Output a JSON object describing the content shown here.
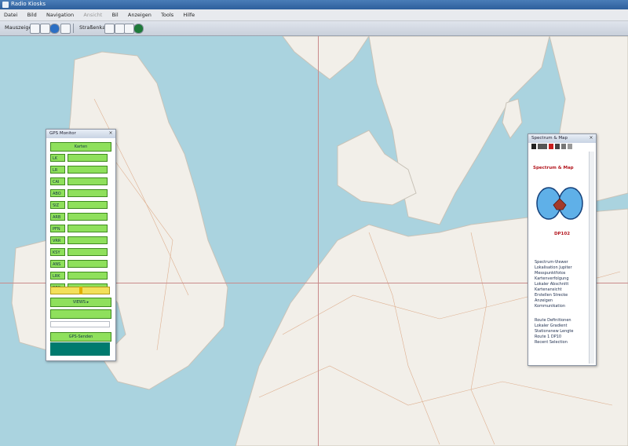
{
  "window": {
    "title": "Radio Kiosks"
  },
  "menu": [
    "Datei",
    "Bild",
    "Navigation",
    "Ansicht",
    "Bil",
    "Anzeigen",
    "Tools",
    "Hilfe"
  ],
  "toolbar": {
    "mode_label": "Mauszeiger",
    "layer_label": "Straßenkarte"
  },
  "gps_panel": {
    "title": "GPS Monitor",
    "header_button": "Karten",
    "rows": [
      "LK",
      "LR",
      "CAI",
      "ABO",
      "SIZ",
      "ARB",
      "PFN",
      "VRR",
      "KSY",
      "ANS",
      "LRK",
      "REC"
    ],
    "mid_button": "VIEWS ▸",
    "bottom_button": "GPS-Senden"
  },
  "info_panel": {
    "title": "Spectrum & Map",
    "heading": "Spectrum & Map",
    "code": "DP102",
    "text_lines_1": [
      "Spectrum-Viewer",
      "Lokalisation Jupiter",
      "Messpunktfotos",
      "Kartenverfolgung",
      "Lokaler Abschnitt",
      "Kartenansicht",
      "Erstellen Strecke",
      "Anzeigen",
      "Kommunikation"
    ],
    "text_lines_2": [
      "Route Definitionen",
      "Lokaler Gradient",
      "Stationsnew Lengte",
      "Route 1 DP10",
      "Recent Selection"
    ]
  },
  "colors": {
    "sea": "#aad3df",
    "land": "#f2efe9",
    "green_button": "#8fe05c",
    "teal_footer": "#007a6e",
    "grid_line": "#c98a8a"
  }
}
